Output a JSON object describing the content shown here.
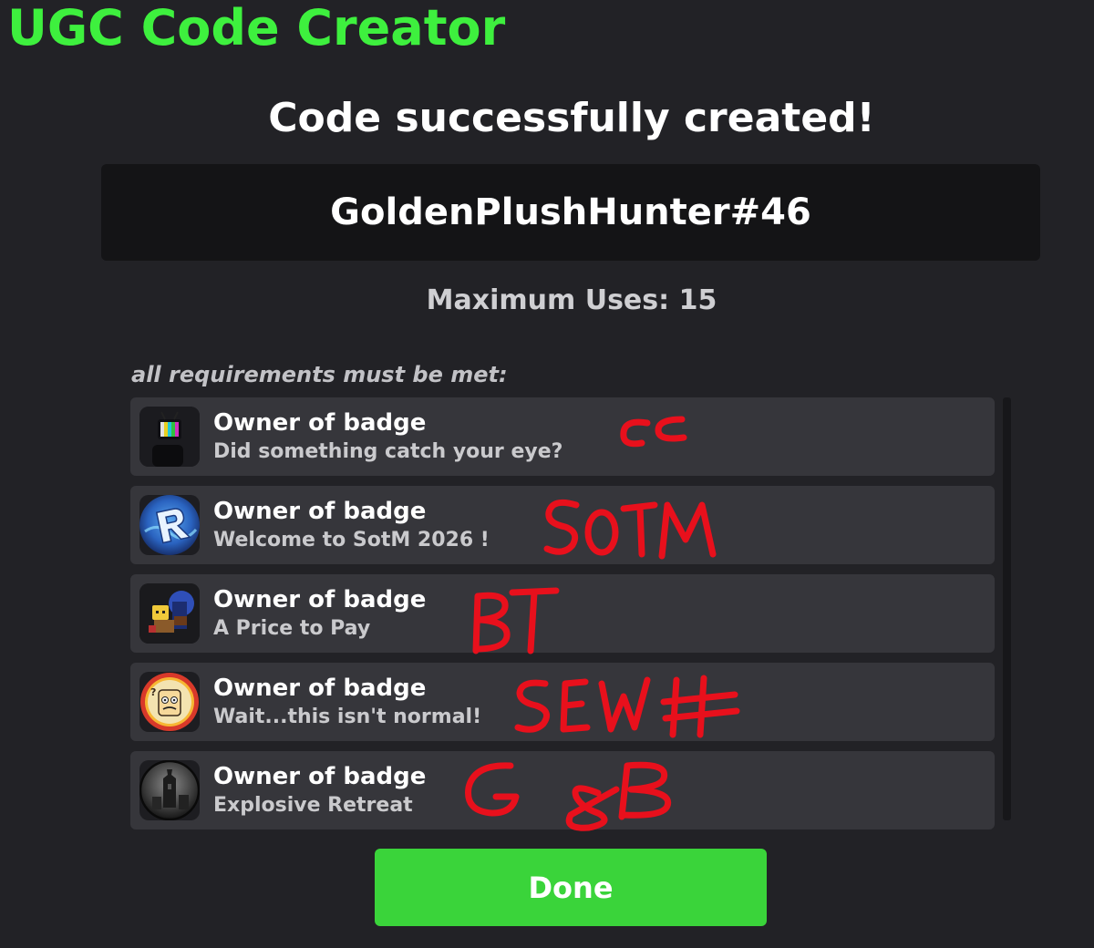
{
  "app": {
    "title": "UGC Code Creator"
  },
  "result": {
    "heading": "Code successfully created!",
    "code": "GoldenPlushHunter#46",
    "max_uses": "Maximum Uses: 15"
  },
  "requirements": {
    "header": "all requirements must be met:",
    "items": [
      {
        "title": "Owner of badge",
        "badge_name": "Did something catch your eye?",
        "icon": "tv-head-character-icon",
        "note": "CC"
      },
      {
        "title": "Owner of badge",
        "badge_name": "Welcome to SotM 2026 !",
        "icon": "blue-r-logo-icon",
        "note": "SOTM"
      },
      {
        "title": "Owner of badge",
        "badge_name": "A Price to Pay",
        "icon": "blocky-character-icon",
        "note": "BT"
      },
      {
        "title": "Owner of badge",
        "badge_name": "Wait...this isn't normal!",
        "icon": "cartoon-face-icon",
        "note": "SEWH"
      },
      {
        "title": "Owner of badge",
        "badge_name": "Explosive Retreat",
        "icon": "dark-tower-icon",
        "note": "G&B"
      }
    ]
  },
  "actions": {
    "done_label": "Done"
  },
  "colors": {
    "background": "#222226",
    "accent_green": "#3ef03e",
    "button_green": "#3ad43a",
    "code_box": "#141416",
    "row_bg": "#36363b",
    "annotation_red": "#e8101c"
  }
}
